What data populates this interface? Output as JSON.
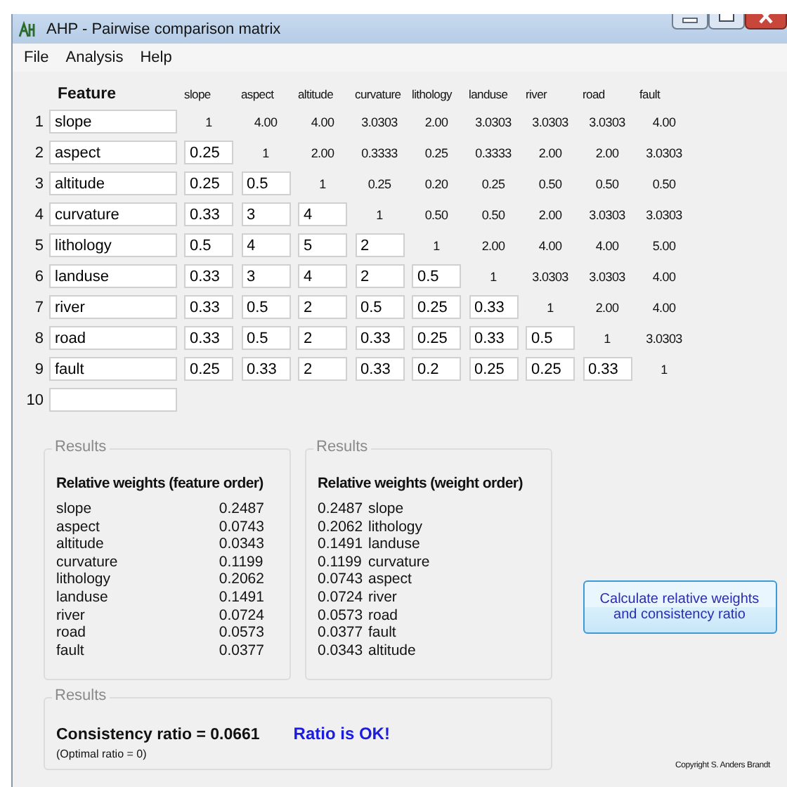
{
  "window": {
    "title": "AHP - Pairwise comparison matrix"
  },
  "menu": [
    "File",
    "Analysis",
    "Help"
  ],
  "matrix": {
    "feature_header": "Feature",
    "columns": [
      "slope",
      "aspect",
      "altitude",
      "curvature",
      "lithology",
      "landuse",
      "river",
      "road",
      "fault"
    ],
    "rows": [
      {
        "number": "1",
        "feature": "slope",
        "cells": [
          {
            "kind": "text",
            "value": "1"
          },
          {
            "kind": "text",
            "value": "4.00"
          },
          {
            "kind": "text",
            "value": "4.00"
          },
          {
            "kind": "text",
            "value": "3.0303"
          },
          {
            "kind": "text",
            "value": "2.00"
          },
          {
            "kind": "text",
            "value": "3.0303"
          },
          {
            "kind": "text",
            "value": "3.0303"
          },
          {
            "kind": "text",
            "value": "3.0303"
          },
          {
            "kind": "text",
            "value": "4.00"
          }
        ]
      },
      {
        "number": "2",
        "feature": "aspect",
        "cells": [
          {
            "kind": "input",
            "value": "0.25"
          },
          {
            "kind": "text",
            "value": "1"
          },
          {
            "kind": "text",
            "value": "2.00"
          },
          {
            "kind": "text",
            "value": "0.3333"
          },
          {
            "kind": "text",
            "value": "0.25"
          },
          {
            "kind": "text",
            "value": "0.3333"
          },
          {
            "kind": "text",
            "value": "2.00"
          },
          {
            "kind": "text",
            "value": "2.00"
          },
          {
            "kind": "text",
            "value": "3.0303"
          }
        ]
      },
      {
        "number": "3",
        "feature": "altitude",
        "cells": [
          {
            "kind": "input",
            "value": "0.25"
          },
          {
            "kind": "input",
            "value": "0.5"
          },
          {
            "kind": "text",
            "value": "1"
          },
          {
            "kind": "text",
            "value": "0.25"
          },
          {
            "kind": "text",
            "value": "0.20"
          },
          {
            "kind": "text",
            "value": "0.25"
          },
          {
            "kind": "text",
            "value": "0.50"
          },
          {
            "kind": "text",
            "value": "0.50"
          },
          {
            "kind": "text",
            "value": "0.50"
          }
        ]
      },
      {
        "number": "4",
        "feature": "curvature",
        "cells": [
          {
            "kind": "input",
            "value": "0.33"
          },
          {
            "kind": "input",
            "value": "3"
          },
          {
            "kind": "input",
            "value": "4"
          },
          {
            "kind": "text",
            "value": "1"
          },
          {
            "kind": "text",
            "value": "0.50"
          },
          {
            "kind": "text",
            "value": "0.50"
          },
          {
            "kind": "text",
            "value": "2.00"
          },
          {
            "kind": "text",
            "value": "3.0303"
          },
          {
            "kind": "text",
            "value": "3.0303"
          }
        ]
      },
      {
        "number": "5",
        "feature": "lithology",
        "cells": [
          {
            "kind": "input",
            "value": "0.5"
          },
          {
            "kind": "input",
            "value": "4"
          },
          {
            "kind": "input",
            "value": "5"
          },
          {
            "kind": "input",
            "value": "2"
          },
          {
            "kind": "text",
            "value": "1"
          },
          {
            "kind": "text",
            "value": "2.00"
          },
          {
            "kind": "text",
            "value": "4.00"
          },
          {
            "kind": "text",
            "value": "4.00"
          },
          {
            "kind": "text",
            "value": "5.00"
          }
        ]
      },
      {
        "number": "6",
        "feature": "landuse",
        "cells": [
          {
            "kind": "input",
            "value": "0.33"
          },
          {
            "kind": "input",
            "value": "3"
          },
          {
            "kind": "input",
            "value": "4"
          },
          {
            "kind": "input",
            "value": "2"
          },
          {
            "kind": "input",
            "value": "0.5"
          },
          {
            "kind": "text",
            "value": "1"
          },
          {
            "kind": "text",
            "value": "3.0303"
          },
          {
            "kind": "text",
            "value": "3.0303"
          },
          {
            "kind": "text",
            "value": "4.00"
          }
        ]
      },
      {
        "number": "7",
        "feature": "river",
        "cells": [
          {
            "kind": "input",
            "value": "0.33"
          },
          {
            "kind": "input",
            "value": "0.5"
          },
          {
            "kind": "input",
            "value": "2"
          },
          {
            "kind": "input",
            "value": "0.5"
          },
          {
            "kind": "input",
            "value": "0.25"
          },
          {
            "kind": "input",
            "value": "0.33"
          },
          {
            "kind": "text",
            "value": "1"
          },
          {
            "kind": "text",
            "value": "2.00"
          },
          {
            "kind": "text",
            "value": "4.00"
          }
        ]
      },
      {
        "number": "8",
        "feature": "road",
        "cells": [
          {
            "kind": "input",
            "value": "0.33"
          },
          {
            "kind": "input",
            "value": "0.5"
          },
          {
            "kind": "input",
            "value": "2"
          },
          {
            "kind": "input",
            "value": "0.33"
          },
          {
            "kind": "input",
            "value": "0.25"
          },
          {
            "kind": "input",
            "value": "0.33"
          },
          {
            "kind": "input",
            "value": "0.5"
          },
          {
            "kind": "text",
            "value": "1"
          },
          {
            "kind": "text",
            "value": "3.0303"
          }
        ]
      },
      {
        "number": "9",
        "feature": "fault",
        "cells": [
          {
            "kind": "input",
            "value": "0.25"
          },
          {
            "kind": "input",
            "value": "0.33"
          },
          {
            "kind": "input",
            "value": "2"
          },
          {
            "kind": "input",
            "value": "0.33"
          },
          {
            "kind": "input",
            "value": "0.2"
          },
          {
            "kind": "input",
            "value": "0.25"
          },
          {
            "kind": "input",
            "value": "0.25"
          },
          {
            "kind": "input",
            "value": "0.33"
          },
          {
            "kind": "text",
            "value": "1"
          }
        ]
      },
      {
        "number": "10"
      }
    ]
  },
  "feature_order": {
    "legend": "Results",
    "heading": "Relative weights (feature order)",
    "items": [
      {
        "name": "slope",
        "weight": "0.2487"
      },
      {
        "name": "aspect",
        "weight": "0.0743"
      },
      {
        "name": "altitude",
        "weight": "0.0343"
      },
      {
        "name": "curvature",
        "weight": "0.1199"
      },
      {
        "name": "lithology",
        "weight": "0.2062"
      },
      {
        "name": "landuse",
        "weight": "0.1491"
      },
      {
        "name": "river",
        "weight": "0.0724"
      },
      {
        "name": "road",
        "weight": "0.0573"
      },
      {
        "name": "fault",
        "weight": "0.0377"
      }
    ]
  },
  "weight_order": {
    "legend": "Results",
    "heading": "Relative weights (weight order)",
    "items": [
      {
        "name": "slope",
        "weight": "0.2487"
      },
      {
        "name": "lithology",
        "weight": "0.2062"
      },
      {
        "name": "landuse",
        "weight": "0.1491"
      },
      {
        "name": "curvature",
        "weight": "0.1199"
      },
      {
        "name": "aspect",
        "weight": "0.0743"
      },
      {
        "name": "river",
        "weight": "0.0724"
      },
      {
        "name": "road",
        "weight": "0.0573"
      },
      {
        "name": "fault",
        "weight": "0.0377"
      },
      {
        "name": "altitude",
        "weight": "0.0343"
      }
    ]
  },
  "calculate_button": "Calculate relative weights and consistency ratio",
  "consistency": {
    "legend": "Results",
    "ratio": "Consistency ratio = 0.0661",
    "verdict": "Ratio is OK!",
    "note": "(Optimal ratio = 0)"
  },
  "copyright": "Copyright S. Anders Brandt"
}
